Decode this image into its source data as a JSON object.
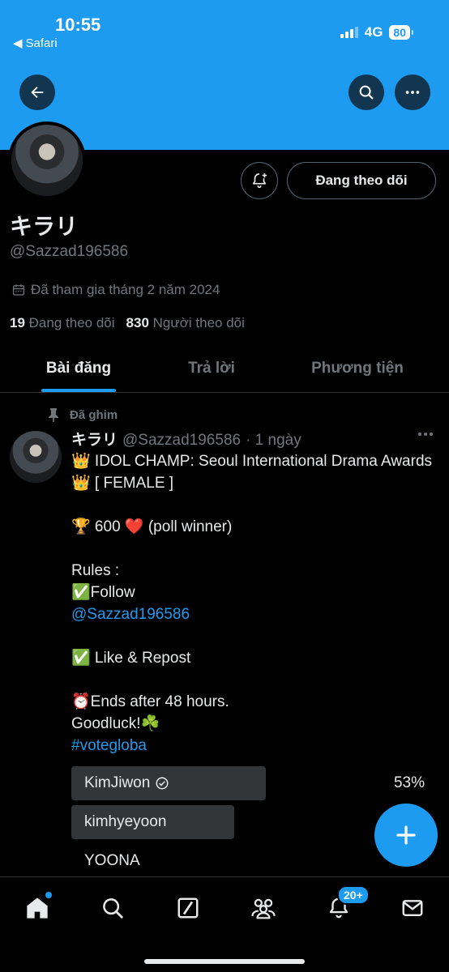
{
  "status": {
    "time": "10:55",
    "back_app": "Safari",
    "network": "4G",
    "battery": "80"
  },
  "profile": {
    "display_name": "キラリ",
    "handle": "@Sazzad196586",
    "joined": "Đã tham gia tháng 2 năm 2024",
    "following_count": "19",
    "following_label": "Đang theo dõi",
    "followers_count": "830",
    "followers_label": "Người theo dõi",
    "follow_button": "Đang theo dõi"
  },
  "tabs": [
    {
      "label": "Bài đăng",
      "active": true
    },
    {
      "label": "Trả lời",
      "active": false
    },
    {
      "label": "Phương tiện",
      "active": false
    }
  ],
  "post": {
    "pinned_label": "Đã ghim",
    "author_name": "キラリ",
    "author_handle": "@Sazzad196586",
    "time": "· 1 ngày",
    "line1": "👑 IDOL CHAMP: Seoul International Drama Awards 👑 [ FEMALE ]",
    "line2": "🏆 600 ❤️ (poll winner)",
    "rules_label": "Rules :",
    "rule1": "✅Follow",
    "mention": "@Sazzad196586",
    "rule2": "✅ Like & Repost",
    "ends": "⏰Ends after 48 hours.",
    "goodluck": "Goodluck!☘️",
    "hashtag": "#votegloba"
  },
  "poll": {
    "options": [
      {
        "label": "KimJiwon",
        "percent_text": "53%",
        "fraction": 0.53,
        "winner": true
      },
      {
        "label": "kimhyeyoon",
        "percent_text": "",
        "fraction": 0.47,
        "winner": false
      },
      {
        "label": "YOONA",
        "percent_text": "",
        "fraction": 0.0,
        "winner": false
      }
    ]
  },
  "nav": {
    "notifications_badge": "20+"
  },
  "colors": {
    "accent": "#1d9bf0",
    "background": "#000000",
    "muted": "#71767b",
    "text": "#e7e9ea"
  }
}
